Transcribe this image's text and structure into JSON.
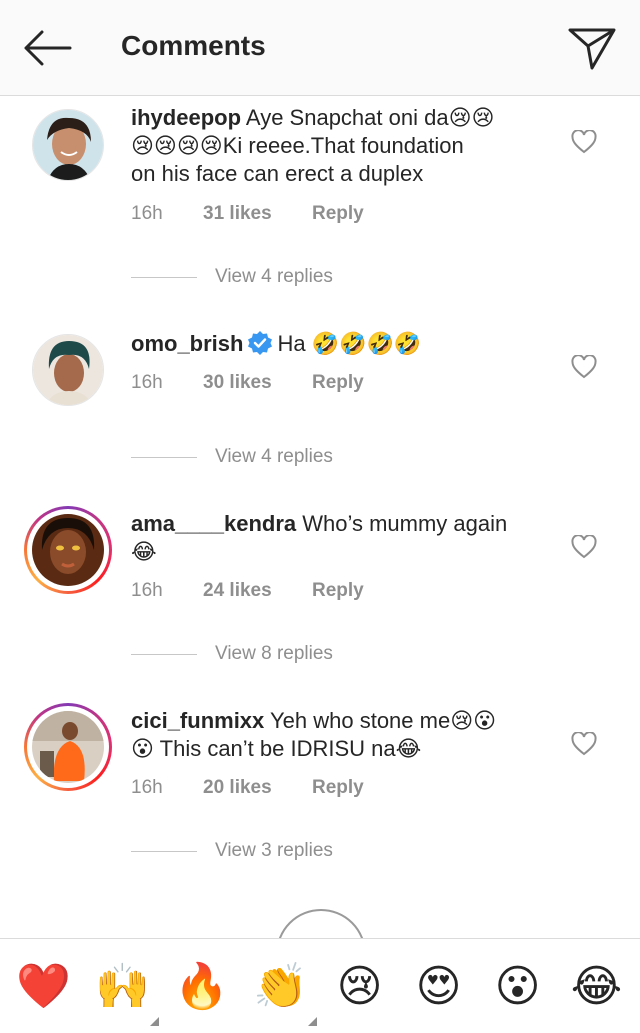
{
  "header": {
    "title": "Comments"
  },
  "comments": [
    {
      "username": "ihydeepop",
      "text_lines": [
        "Aye Snapchat oni da😢😢",
        "😢😢😢😢Ki reeee.That foundation",
        "on his face can erect a duplex"
      ],
      "time": "16h",
      "likes": "31 likes",
      "reply": "Reply",
      "view_replies": "View 4 replies"
    },
    {
      "username": "omo_brish",
      "text": "Ha 🤣🤣🤣🤣",
      "time": "16h",
      "likes": "30 likes",
      "reply": "Reply",
      "view_replies": "View 4 replies"
    },
    {
      "username": "ama____kendra",
      "text_lines": [
        "Who’s mummy again",
        "😂"
      ],
      "time": "16h",
      "likes": "24 likes",
      "reply": "Reply",
      "view_replies": "View 8 replies"
    },
    {
      "username": "cici_funmixx",
      "text_lines": [
        "Yeh who stone me😢😮",
        "😮 This can’t be IDRISU na😂"
      ],
      "time": "16h",
      "likes": "20 likes",
      "reply": "Reply",
      "view_replies": "View 3 replies"
    }
  ],
  "emoji_bar": [
    "❤️",
    "🙌",
    "🔥",
    "👏",
    "😢",
    "😍",
    "😮",
    "😂"
  ],
  "colors": {
    "accent": "#3897f0",
    "muted": "#8e8e8e",
    "text": "#262626",
    "heart": "#ed4956"
  }
}
